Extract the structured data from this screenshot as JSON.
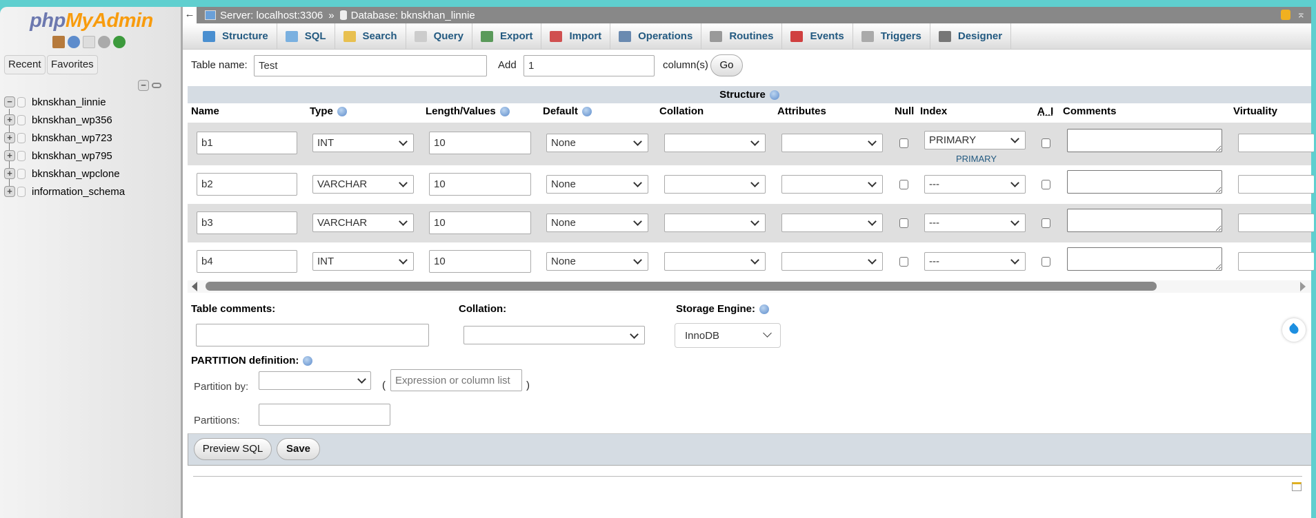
{
  "sidebar": {
    "logo": {
      "part1": "php",
      "part2": "MyAdmin"
    },
    "icons": [
      "home-icon",
      "help-icon",
      "docs-icon",
      "settings-icon",
      "reload-icon"
    ],
    "recent_label": "Recent",
    "favorites_label": "Favorites",
    "databases": [
      {
        "name": "bknskhan_linnie",
        "expanded": true
      },
      {
        "name": "bknskhan_wp356",
        "expanded": false
      },
      {
        "name": "bknskhan_wp723",
        "expanded": false
      },
      {
        "name": "bknskhan_wp795",
        "expanded": false
      },
      {
        "name": "bknskhan_wpclone",
        "expanded": false
      },
      {
        "name": "information_schema",
        "expanded": false
      }
    ]
  },
  "breadcrumb": {
    "server": "Server: localhost:3306",
    "separator": "»",
    "database": "Database: bknskhan_linnie"
  },
  "tabs": [
    {
      "label": "Structure",
      "icon": "structure-icon",
      "color": "#4a8fd0"
    },
    {
      "label": "SQL",
      "icon": "sql-icon",
      "color": "#7ab0e0"
    },
    {
      "label": "Search",
      "icon": "search-icon",
      "color": "#e8c050"
    },
    {
      "label": "Query",
      "icon": "query-icon",
      "color": "#ccc"
    },
    {
      "label": "Export",
      "icon": "export-icon",
      "color": "#5a9a5a"
    },
    {
      "label": "Import",
      "icon": "import-icon",
      "color": "#d05050"
    },
    {
      "label": "Operations",
      "icon": "wrench-icon",
      "color": "#6a8ab0"
    },
    {
      "label": "Routines",
      "icon": "routines-icon",
      "color": "#999"
    },
    {
      "label": "Events",
      "icon": "clock-icon",
      "color": "#d04040"
    },
    {
      "label": "Triggers",
      "icon": "triggers-icon",
      "color": "#aaa"
    },
    {
      "label": "Designer",
      "icon": "designer-icon",
      "color": "#777"
    }
  ],
  "form": {
    "table_name_label": "Table name:",
    "table_name": "Test",
    "add_label": "Add",
    "add_count": "1",
    "columns_label": "column(s)",
    "go_label": "Go",
    "structure_title": "Structure",
    "headers": {
      "name": "Name",
      "type": "Type",
      "length": "Length/Values",
      "default": "Default",
      "collation": "Collation",
      "attributes": "Attributes",
      "null": "Null",
      "index": "Index",
      "ai": "A_I",
      "comments": "Comments",
      "virtuality": "Virtuality"
    },
    "columns": [
      {
        "name": "b1",
        "type": "INT",
        "length": "10",
        "default": "None",
        "collation": "",
        "attributes": "",
        "null": false,
        "index": "PRIMARY",
        "index_note": "PRIMARY",
        "ai": false,
        "comments": ""
      },
      {
        "name": "b2",
        "type": "VARCHAR",
        "length": "10",
        "default": "None",
        "collation": "",
        "attributes": "",
        "null": false,
        "index": "---",
        "ai": false,
        "comments": ""
      },
      {
        "name": "b3",
        "type": "VARCHAR",
        "length": "10",
        "default": "None",
        "collation": "",
        "attributes": "",
        "null": false,
        "index": "---",
        "ai": false,
        "comments": ""
      },
      {
        "name": "b4",
        "type": "INT",
        "length": "10",
        "default": "None",
        "collation": "",
        "attributes": "",
        "null": false,
        "index": "---",
        "ai": false,
        "comments": ""
      }
    ],
    "table_comments_label": "Table comments:",
    "table_comments": "",
    "collation_label": "Collation:",
    "collation": "",
    "storage_engine_label": "Storage Engine:",
    "storage_engine": "InnoDB",
    "partition_label": "PARTITION definition:",
    "partition_by_label": "Partition by:",
    "partition_by": "",
    "open_paren": "(",
    "close_paren": ")",
    "expression_placeholder": "Expression or column list",
    "partitions_label": "Partitions:",
    "partitions": "",
    "preview_sql_label": "Preview SQL",
    "save_label": "Save"
  }
}
